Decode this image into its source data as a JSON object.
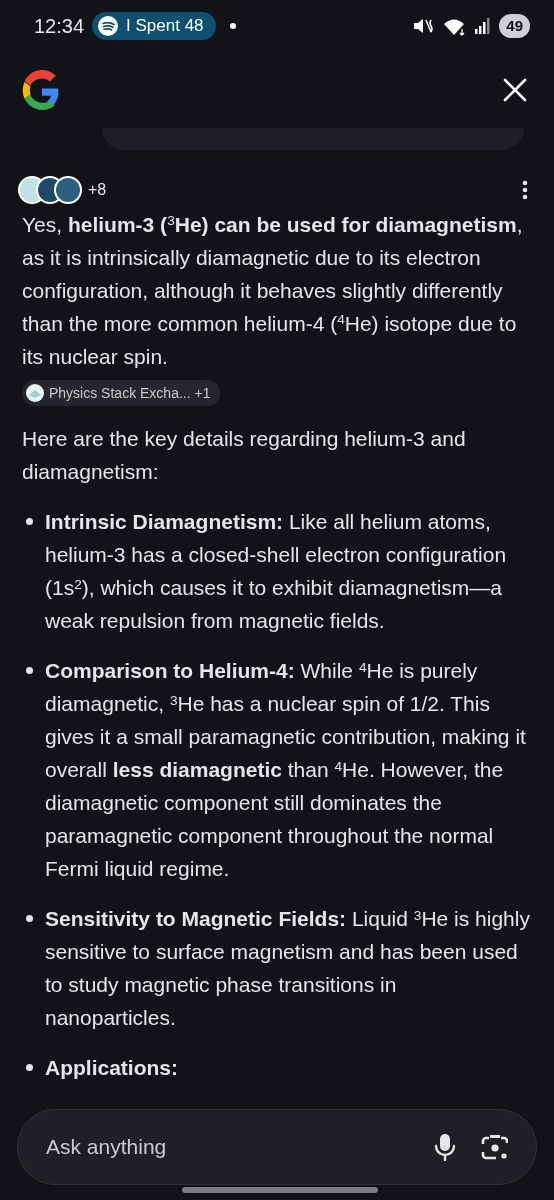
{
  "status_bar": {
    "time": "12:34",
    "media_chip": "I Spent 48",
    "battery": "49"
  },
  "answer": {
    "source_count": "+8",
    "intro": "Yes, **helium-3 (**$^{3}$**He) can be used for diamagnetism**, as it is intrinsically diamagnetic due to its electron configuration, although it behaves slightly differently than the more common helium-4 ($^{4}$He) isotope due to its nuclear spin.",
    "intro_source": {
      "label": "Physics Stack Excha...",
      "count": "+1"
    },
    "lead": "Here are the key details regarding helium-3 and diamagnetism:",
    "bullets": [
      {
        "text": "**Intrinsic Diamagnetism:** Like all helium atoms, helium-3 has a closed-shell electron configuration (1s$^{2}$), which causes it to exhibit diamagnetism—a weak repulsion from magnetic fields."
      },
      {
        "text": "**Comparison to Helium-4:** While $^{4}$He is purely diamagnetic, $^{3}$He has a nuclear spin of 1/2. This gives it a small paramagnetic contribution, making it overall **less diamagnetic** than $^{4}$He. However, the diamagnetic component still dominates the paramagnetic component throughout the normal Fermi liquid regime."
      },
      {
        "text": "**Sensitivity to Magnetic Fields:** Liquid $^{3}$He is highly sensitive to surface magnetism and has been used to study magnetic phase transitions in nanoparticles."
      },
      {
        "text": "**Applications:**"
      }
    ]
  },
  "ask_bar": {
    "placeholder": "Ask anything"
  }
}
